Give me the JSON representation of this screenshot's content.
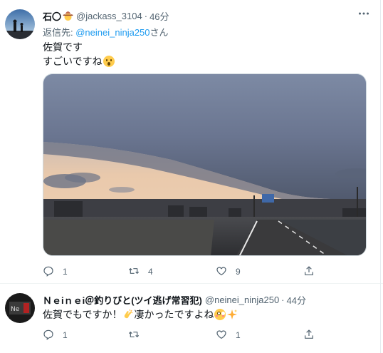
{
  "tweets": [
    {
      "display_name": "石〇🤠",
      "name_text": "石〇",
      "handle": "@jackass_3104",
      "separator": "·",
      "time": "46分",
      "reply_prefix": "返信先: ",
      "reply_handle": "@neinei_ninja250",
      "reply_suffix": "さん",
      "lines": [
        "佐賀です",
        "すごいですね"
      ],
      "emoji": "surprised-face-emoji",
      "photo_alt": "夕暮れの道路と空を覆う雲の写真",
      "stats": {
        "replies": "1",
        "retweets": "4",
        "likes": "9"
      }
    },
    {
      "display_name": "Ｎｅiｎｅi＠釣りびと(ツイ逃げ常習犯)",
      "handle": "@neinei_ninja250",
      "separator": "·",
      "time": "44分",
      "line_a": "佐賀でもですか！",
      "line_b": "凄かったですよね",
      "emojis": [
        "clapping-hands-emoji",
        "flushed-face-emoji",
        "sparkles-emoji"
      ],
      "stats": {
        "replies": "1",
        "retweets": "",
        "likes": "1"
      }
    }
  ],
  "icons": {
    "reply": "reply-icon",
    "retweet": "retweet-icon",
    "like": "heart-icon",
    "share": "share-icon",
    "more": "more-icon"
  },
  "colors": {
    "link": "#1d9bf0",
    "secondary_text": "#536471",
    "primary_text": "#0f1419",
    "divider": "#eff3f4"
  }
}
